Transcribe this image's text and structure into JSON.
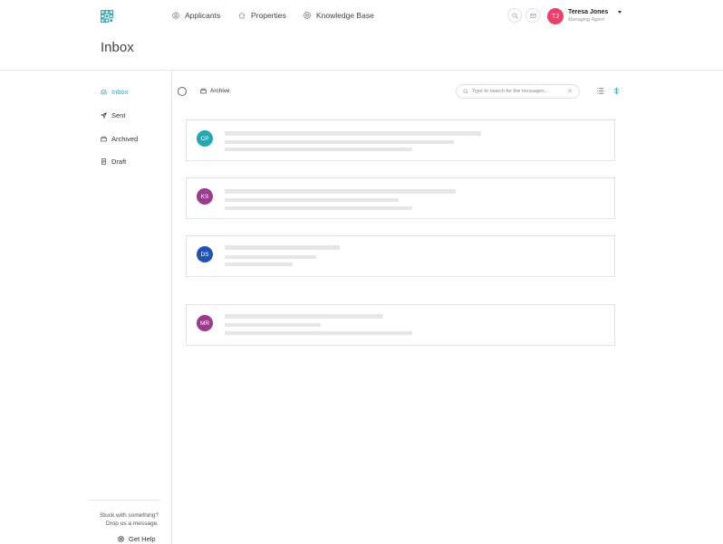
{
  "nav": {
    "items": [
      {
        "label": "Applicants",
        "icon": "user-icon"
      },
      {
        "label": "Properties",
        "icon": "home-icon"
      },
      {
        "label": "Knowledge Base",
        "icon": "lightbulb-icon"
      }
    ]
  },
  "user": {
    "name": "Teresa Jones",
    "role": "Managing Agent",
    "initials": "TJ",
    "avatar_color": "#e8426b"
  },
  "page": {
    "title": "Inbox"
  },
  "sidebar": {
    "items": [
      {
        "label": "Inbox",
        "icon": "inbox-icon",
        "active": true
      },
      {
        "label": "Sent",
        "icon": "send-icon",
        "active": false
      },
      {
        "label": "Archived",
        "icon": "archive-icon",
        "active": false
      },
      {
        "label": "Draft",
        "icon": "draft-icon",
        "active": false
      }
    ],
    "help": {
      "line1": "Stuck with something?",
      "line2": "Drop us a message.",
      "link": "Get Help"
    }
  },
  "toolbar": {
    "archive_label": "Archive",
    "search_placeholder": "Type to search for the messages..."
  },
  "messages": [
    {
      "initials": "CP",
      "color": "#26a8b0"
    },
    {
      "initials": "KS",
      "color": "#9b3a8f"
    },
    {
      "initials": "DS",
      "color": "#1e55b3"
    },
    {
      "initials": "MR",
      "color": "#9b3a8f"
    }
  ],
  "colors": {
    "accent": "#3aa5b5"
  }
}
